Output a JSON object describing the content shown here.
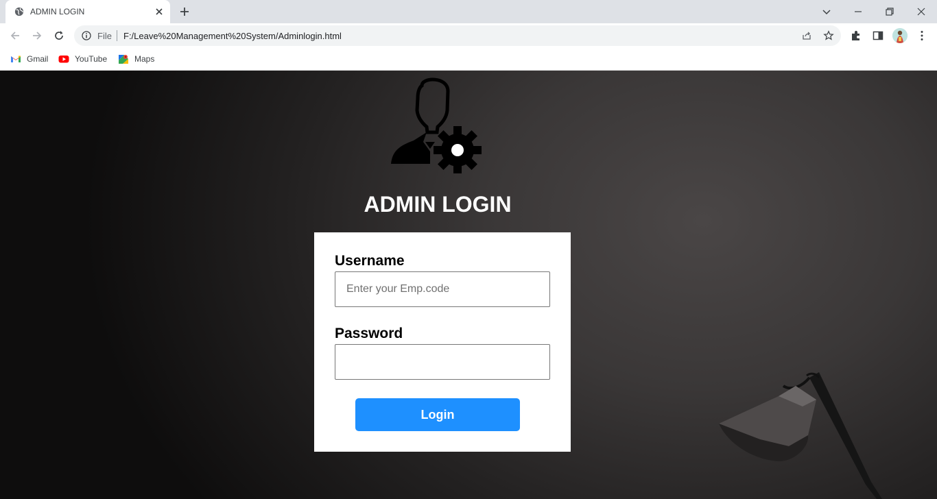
{
  "browser": {
    "tab_title": "ADMIN LOGIN",
    "omnibox": {
      "scheme_label": "File",
      "url": "F:/Leave%20Management%20System/Adminlogin.html"
    },
    "bookmarks": [
      {
        "label": "Gmail",
        "icon": "gmail-icon"
      },
      {
        "label": "YouTube",
        "icon": "youtube-icon"
      },
      {
        "label": "Maps",
        "icon": "maps-icon"
      }
    ]
  },
  "page": {
    "title": "ADMIN LOGIN",
    "form": {
      "username": {
        "label": "Username",
        "placeholder": "Enter your Emp.code",
        "value": ""
      },
      "password": {
        "label": "Password",
        "placeholder": "",
        "value": ""
      },
      "submit_label": "Login"
    }
  },
  "colors": {
    "button": "#1e90ff",
    "title": "#ffffff",
    "card": "#ffffff"
  }
}
